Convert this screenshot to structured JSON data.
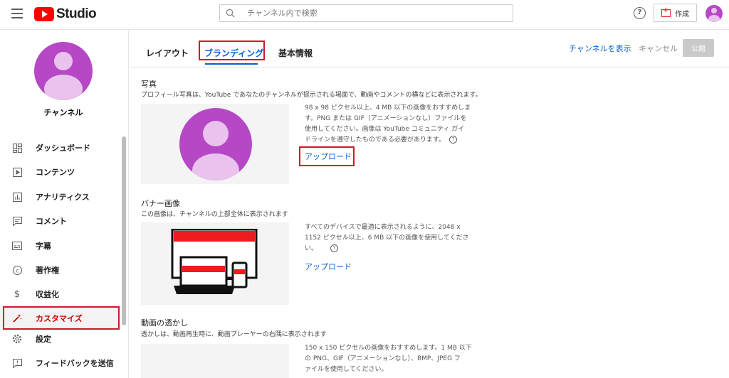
{
  "header": {
    "app_name": "Studio",
    "search_placeholder": "チャンネル内で検索",
    "help_label": "?",
    "create_label": "作成"
  },
  "sidebar": {
    "channel_name": "チャンネル",
    "items": [
      {
        "label": "ダッシュボード",
        "icon": "dashboard-icon"
      },
      {
        "label": "コンテンツ",
        "icon": "content-icon"
      },
      {
        "label": "アナリティクス",
        "icon": "analytics-icon"
      },
      {
        "label": "コメント",
        "icon": "comment-icon"
      },
      {
        "label": "字幕",
        "icon": "subtitles-icon"
      },
      {
        "label": "著作権",
        "icon": "copyright-icon"
      },
      {
        "label": "収益化",
        "icon": "monetization-icon"
      },
      {
        "label": "カスタマイズ",
        "icon": "customize-icon"
      },
      {
        "label": "設定",
        "icon": "settings-icon"
      },
      {
        "label": "フィードバックを送信",
        "icon": "feedback-icon"
      }
    ]
  },
  "tabs": [
    {
      "label": "レイアウト"
    },
    {
      "label": "ブランディング"
    },
    {
      "label": "基本情報"
    }
  ],
  "actions": {
    "view_channel": "チャンネルを表示",
    "cancel": "キャンセル",
    "publish": "公開"
  },
  "sections": {
    "photo": {
      "title": "写真",
      "desc": "プロフィール写真は、YouTube であなたのチャンネルが提示される場面で、動画やコメントの横などに表示されます。",
      "info_lines": [
        "98 x 98 ピクセル以上、4 MB 以下の画像をおすすめしま",
        "す。PNG または GIF（アニメーションなし）ファイルを",
        "使用してください。画像は YouTube コミュニティ ガイ",
        "ドラインを遵守したものである必要があります。"
      ],
      "upload": "アップロード"
    },
    "banner": {
      "title": "バナー画像",
      "desc": "この画像は、チャンネルの上部全体に表示されます",
      "info_lines": [
        "すべてのデバイスで最適に表示されるように、2048 x",
        "1152 ピクセル以上、6 MB 以下の画像を使用してくださ",
        "い。"
      ],
      "upload": "アップロード"
    },
    "watermark": {
      "title": "動画の透かし",
      "desc": "透かしは、動画再生時に、動画プレーヤーの右隅に表示されます",
      "info_lines": [
        "150 x 150 ピクセルの画像をおすすめします。1 MB 以下",
        "の PNG、GIF（アニメーションなし）、BMP、JPEG フ",
        "ァイルを使用してください。"
      ]
    }
  },
  "colors": {
    "accent": "#065fd4",
    "brand": "#ff0000",
    "avatar": "#b648c6",
    "highlight_box": "#d3182b"
  }
}
